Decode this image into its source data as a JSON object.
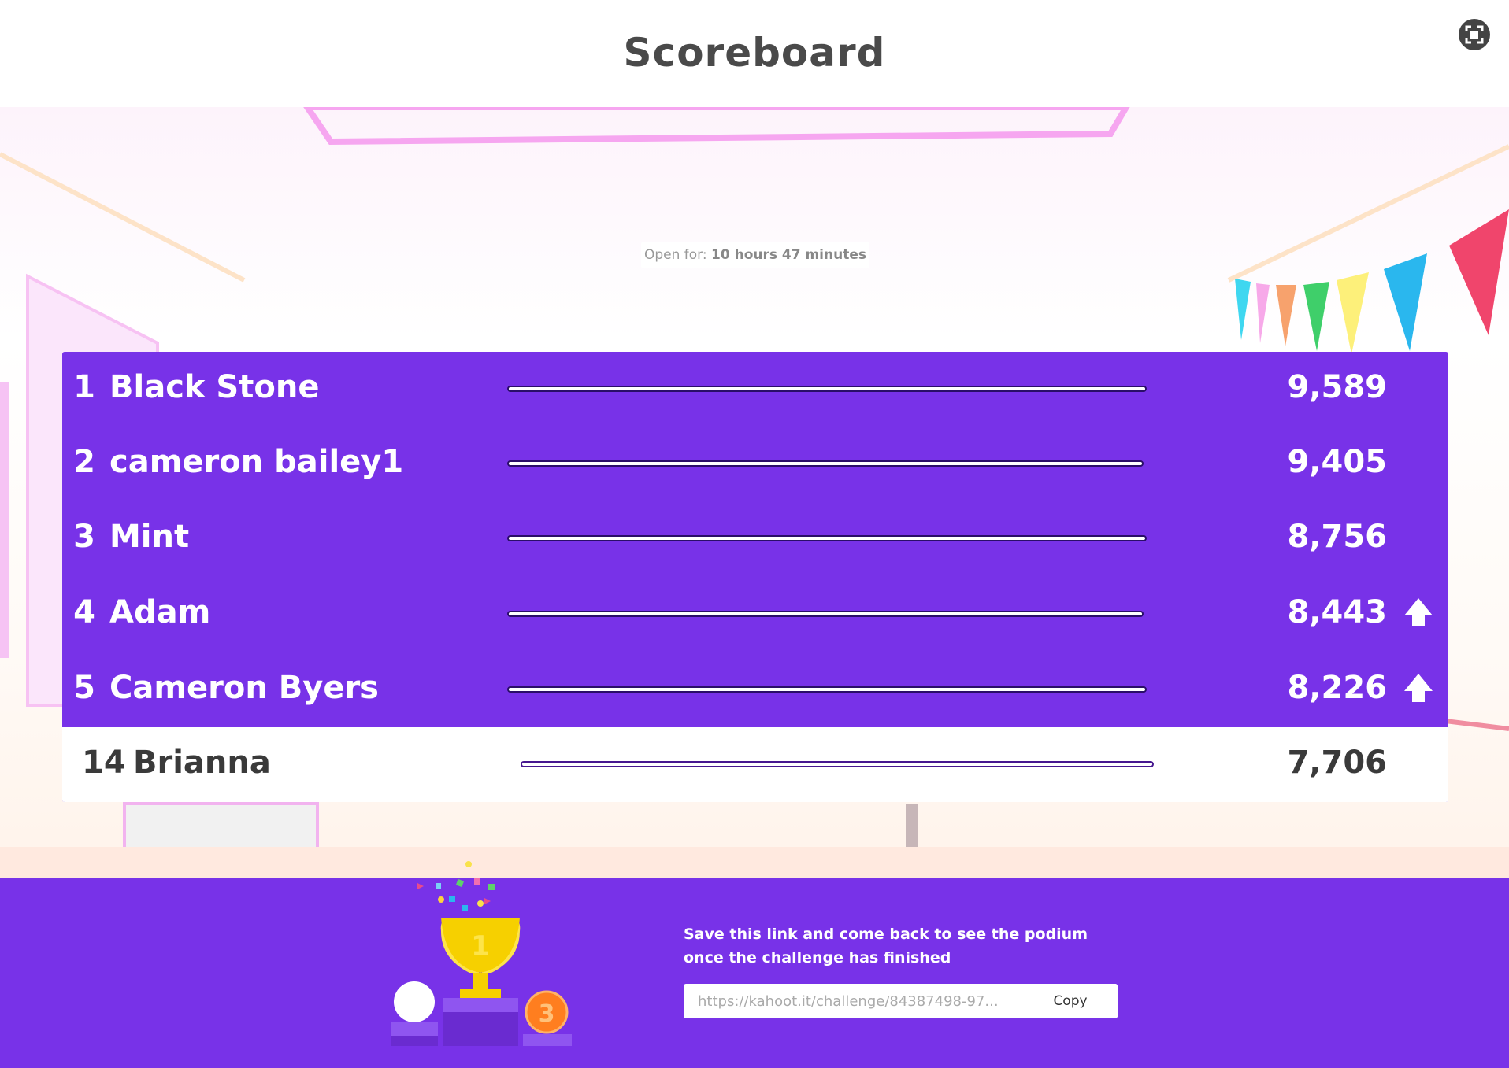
{
  "header": {
    "title": "Scoreboard",
    "fullscreen_icon": "fullscreen-icon"
  },
  "status": {
    "open_for_label": "Open for:",
    "open_for_value": "10 hours 47 minutes"
  },
  "scoreboard": {
    "rows": [
      {
        "rank": "1",
        "name": "Black Stone",
        "score": "9,589",
        "bar_fraction": 0.99,
        "trend": ""
      },
      {
        "rank": "2",
        "name": "cameron bailey1",
        "score": "9,405",
        "bar_fraction": 0.985,
        "trend": ""
      },
      {
        "rank": "3",
        "name": "Mint",
        "score": "8,756",
        "bar_fraction": 0.99,
        "trend": ""
      },
      {
        "rank": "4",
        "name": "Adam",
        "score": "8,443",
        "bar_fraction": 0.985,
        "trend": "up"
      },
      {
        "rank": "5",
        "name": "Cameron Byers",
        "score": "8,226",
        "bar_fraction": 0.99,
        "trend": "up"
      }
    ],
    "self_row": {
      "rank": "14",
      "name": "Brianna",
      "score": "7,706",
      "bar_fraction": 0.98
    }
  },
  "footer": {
    "save_message": "Save this link and come back to see the podium once the challenge has finished",
    "link_value": "https://kahoot.it/challenge/84387498-97...",
    "copy_label": "Copy",
    "podium_icon": "trophy-podium-icon",
    "third_place_medal": "3"
  },
  "colors": {
    "accent": "#7832e8",
    "bar_border": "#2a0e68",
    "text_dark": "#3a3a3a"
  }
}
